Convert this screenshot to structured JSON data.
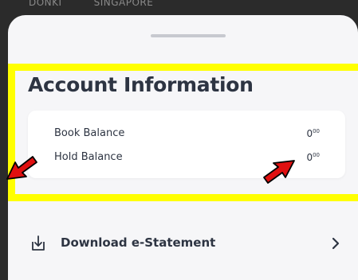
{
  "background": {
    "text_left": "DONKI",
    "text_right": "SINGAPORE"
  },
  "account": {
    "title": "Account Information",
    "rows": [
      {
        "label": "Book Balance",
        "value": "0",
        "decimals": "00"
      },
      {
        "label": "Hold Balance",
        "value": "0",
        "decimals": "00"
      }
    ]
  },
  "download": {
    "label": "Download e-Statement",
    "icon": "download-icon"
  },
  "colors": {
    "highlight": "#ffff00",
    "arrow": "#e01010",
    "text": "#2d3442",
    "sheet": "#f6f6f8"
  }
}
